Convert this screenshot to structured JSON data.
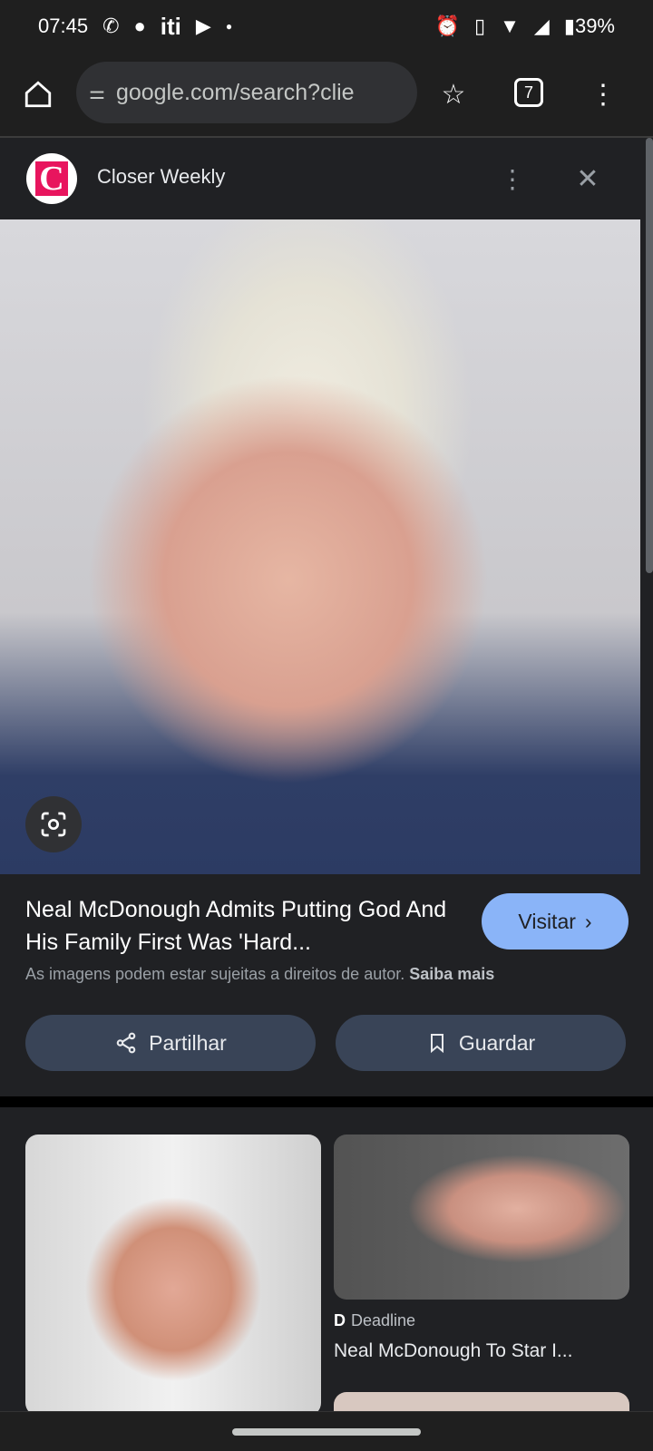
{
  "status_bar": {
    "time": "07:45",
    "app_text": "iti",
    "battery": "39%"
  },
  "browser": {
    "url": "google.com/search?clie",
    "tab_count": "7"
  },
  "header": {
    "source": "Closer Weekly",
    "logo_letter": "C"
  },
  "result": {
    "title": "Neal McDonough Admits Putting God And His Family First Was 'Hard...",
    "visit_label": "Visitar",
    "copyright": "As imagens podem estar sujeitas a direitos de autor.",
    "learn_more": "Saiba mais",
    "share_label": "Partilhar",
    "save_label": "Guardar"
  },
  "related": [
    {
      "source": "Deadline",
      "title": "Neal McDonough To Star I..."
    }
  ]
}
